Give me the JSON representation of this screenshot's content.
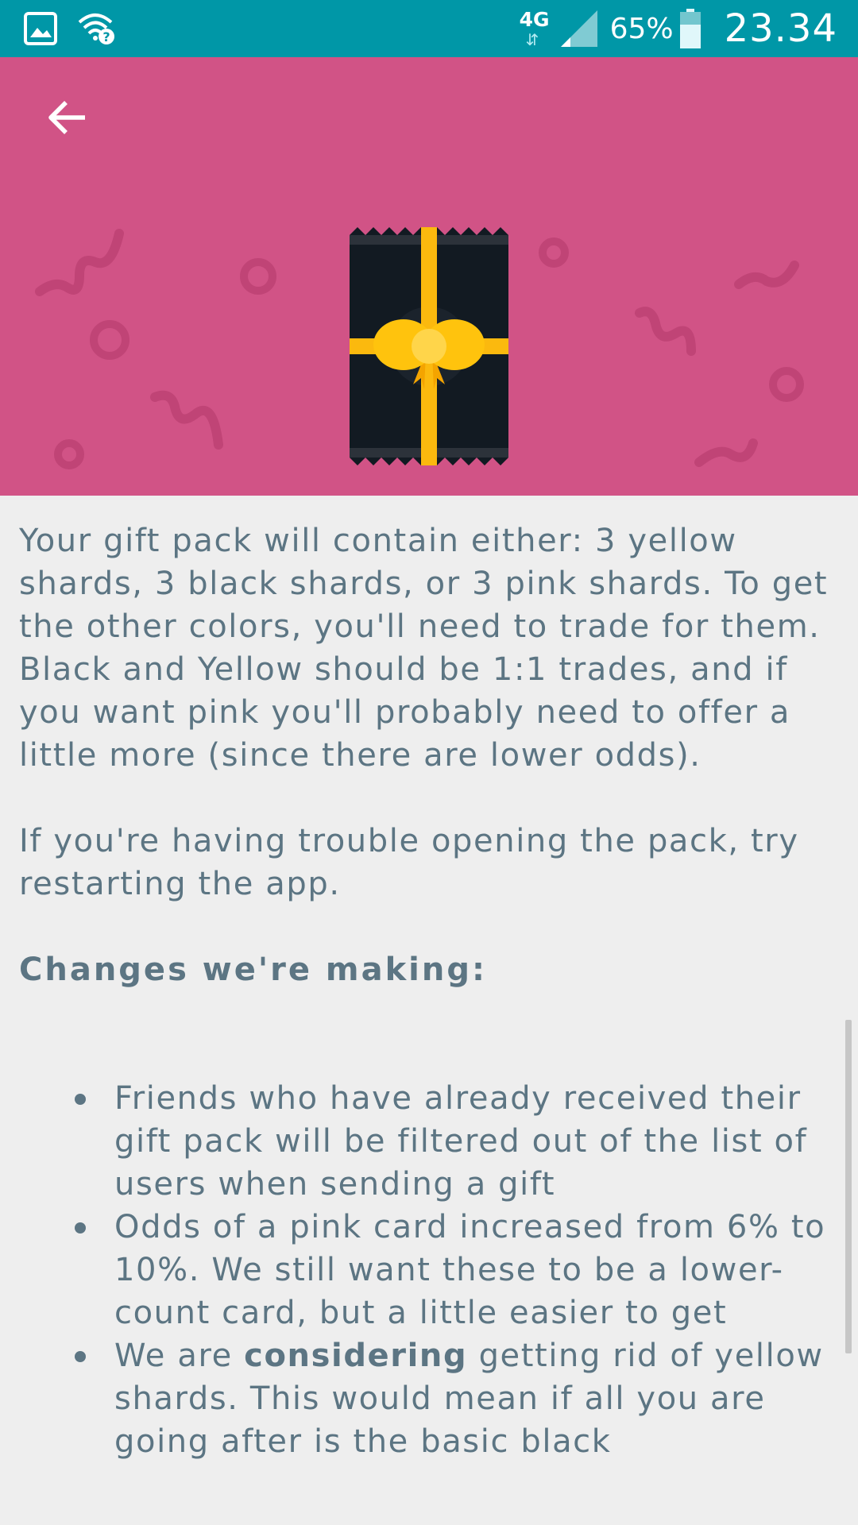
{
  "status_bar": {
    "network": "4G",
    "battery_percent": "65%",
    "time": "23.34"
  },
  "colors": {
    "status_bar": "#0097a7",
    "hero_background": "#d15386",
    "text": "#5c7583",
    "page_background": "#eeeeee"
  },
  "header": {
    "back_icon": "arrow-left-icon",
    "illustration": "gift-pack-illustration"
  },
  "body": {
    "paragraph_1": "Your gift pack will contain either: 3 yellow shards, 3 black shards, or 3 pink shards. To get the other colors, you'll need to trade for them. Black and Yellow should be 1:1 trades, and if you want pink you'll probably need to offer a little more (since there are lower odds).",
    "paragraph_2": "If you're having trouble opening the pack, try restarting the app.",
    "changes_heading": "Changes we're making:",
    "changes": [
      "Friends who have already received their gift pack will be filtered out of the list of users when sending a gift",
      "Odds of a pink card increased from 6% to 10%. We still want these to be a lower-count card, but a little easier to get"
    ],
    "change_3": {
      "prefix": "We are ",
      "emphasis": "considering",
      "suffix": " getting rid of yellow shards. This would mean if all you are going after is the basic black"
    }
  }
}
